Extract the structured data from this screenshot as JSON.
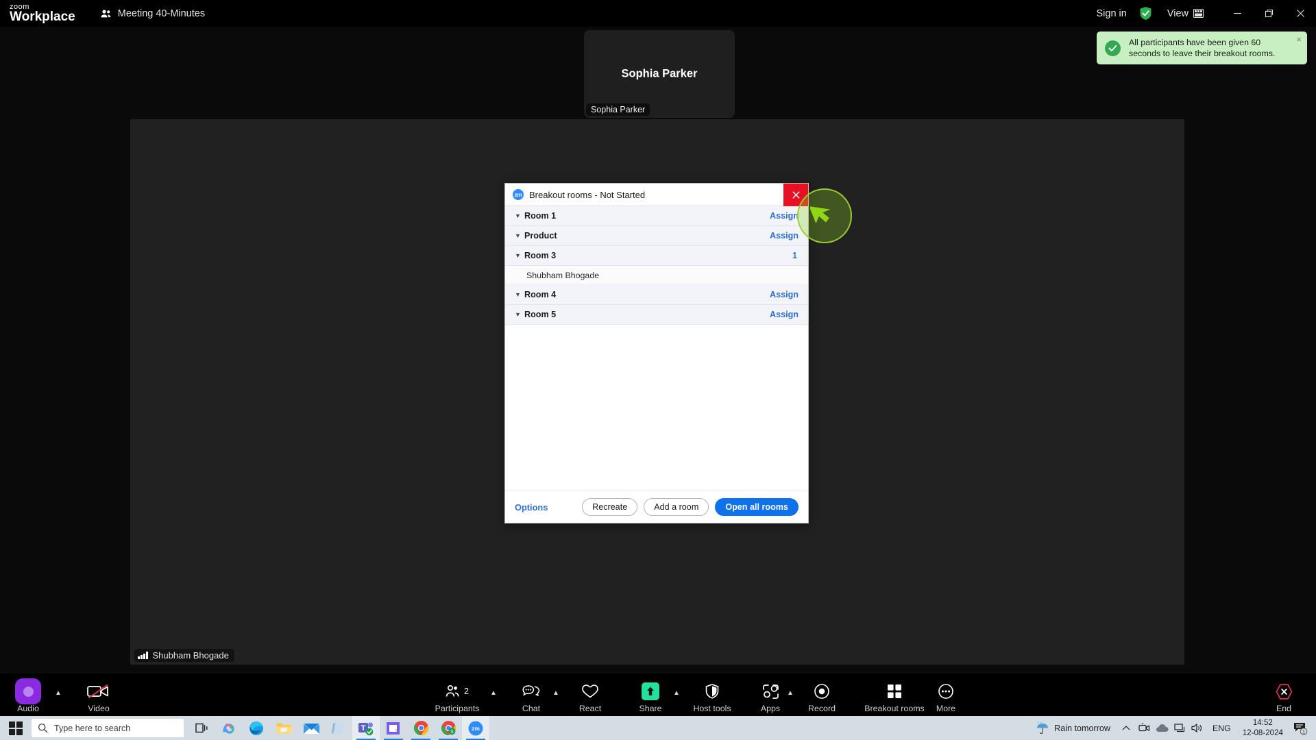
{
  "titlebar": {
    "logo_line1": "zoom",
    "logo_line2": "Workplace",
    "meeting_title": "Meeting 40-Minutes",
    "sign_in": "Sign in",
    "view": "View",
    "minimize_icon": "minimize-icon",
    "restore_icon": "restore-icon",
    "close_icon": "close-icon"
  },
  "toast": {
    "message": "All participants have been given 60 seconds to leave their breakout rooms.",
    "close_label": "×",
    "bg_color": "#c8efc2",
    "check_color": "#32a852"
  },
  "video_tile": {
    "display_name": "Sophia Parker",
    "name_label": "Sophia Parker"
  },
  "shared_content": {
    "presenter_label": "Shubham Bhogade"
  },
  "dialog": {
    "title": "Breakout rooms - Not Started",
    "badge": "zm",
    "close_label": "✕",
    "rooms": [
      {
        "name": "Room 1",
        "action": "Assign",
        "count": null,
        "members": []
      },
      {
        "name": "Product",
        "action": "Assign",
        "count": null,
        "members": []
      },
      {
        "name": "Room 3",
        "action": null,
        "count": "1",
        "members": [
          "Shubham Bhogade"
        ]
      },
      {
        "name": "Room 4",
        "action": "Assign",
        "count": null,
        "members": []
      },
      {
        "name": "Room 5",
        "action": "Assign",
        "count": null,
        "members": []
      }
    ],
    "footer": {
      "options": "Options",
      "recreate": "Recreate",
      "add_room": "Add a room",
      "open_all": "Open all rooms"
    },
    "accent_color": "#0e72ed",
    "link_color": "#2d6fdb"
  },
  "toolbar": {
    "audio": "Audio",
    "video": "Video",
    "participants": "Participants",
    "participants_count": "2",
    "chat": "Chat",
    "react": "React",
    "share": "Share",
    "host_tools": "Host tools",
    "apps": "Apps",
    "record": "Record",
    "breakout_rooms": "Breakout rooms",
    "more": "More",
    "end": "End",
    "end_color": "#e02f4e",
    "share_color": "#25e09a",
    "audio_color": "#8a2be2"
  },
  "taskbar": {
    "search_placeholder": "Type here to search",
    "weather": "Rain tomorrow",
    "language": "ENG",
    "time": "14:52",
    "date": "12-08-2024",
    "notification_count": "1",
    "apps": [
      {
        "name": "copilot-icon"
      },
      {
        "name": "edge-icon"
      },
      {
        "name": "file-explorer-icon"
      },
      {
        "name": "mail-icon"
      },
      {
        "name": "notepad-icon"
      },
      {
        "name": "teams-icon"
      },
      {
        "name": "powerpoint-icon"
      },
      {
        "name": "chrome-icon"
      },
      {
        "name": "chrome-sheets-icon"
      },
      {
        "name": "zoom-icon"
      }
    ]
  }
}
